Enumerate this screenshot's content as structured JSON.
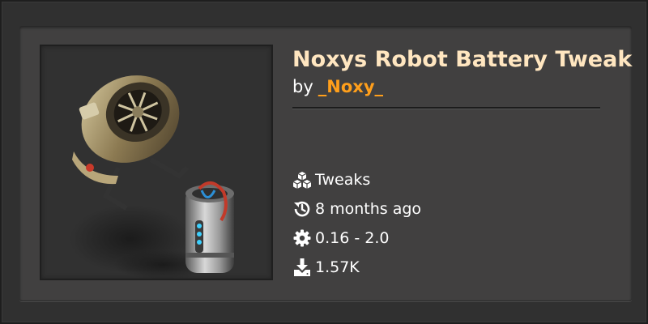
{
  "mod": {
    "title": "Noxys Robot Battery Tweak",
    "by_label": "by",
    "author": "_Noxy_",
    "thumbnail_icon": "robot-battery-thumbnail",
    "meta": {
      "category": "Tweaks",
      "updated": "8 months ago",
      "version": "0.16 - 2.0",
      "downloads": "1.57K"
    }
  },
  "colors": {
    "title": "#ffe6c0",
    "author": "#ff9f1b",
    "text": "#ffffff",
    "card": "#414040"
  }
}
